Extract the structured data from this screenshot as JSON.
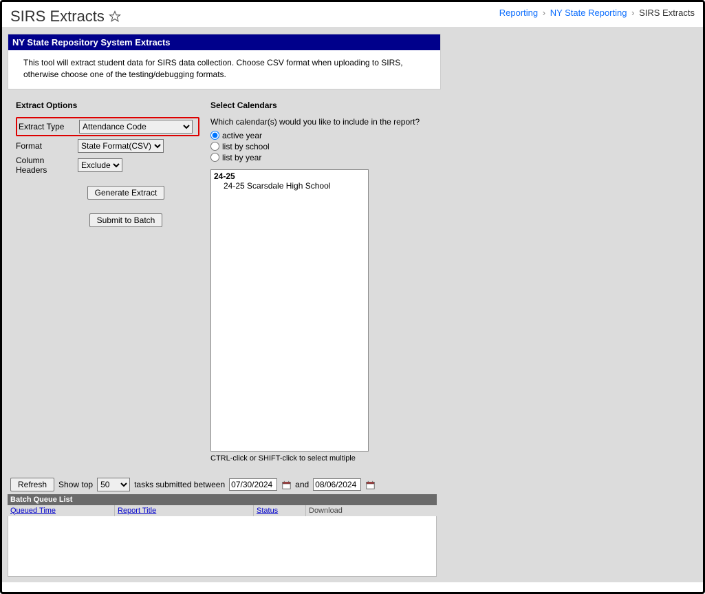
{
  "header": {
    "title": "SIRS Extracts",
    "breadcrumb": {
      "reporting": "Reporting",
      "state": "NY State Reporting",
      "current": "SIRS Extracts"
    }
  },
  "panel": {
    "title": "NY State Repository System Extracts",
    "description": "This tool will extract student data for SIRS data collection. Choose CSV format when uploading to SIRS, otherwise choose one of the testing/debugging formats."
  },
  "extract": {
    "section_label": "Extract Options",
    "type_label": "Extract Type",
    "type_value": "Attendance Code",
    "format_label": "Format",
    "format_value": "State Format(CSV)",
    "colhdr_label": "Column Headers",
    "colhdr_value": "Exclude",
    "generate_btn": "Generate Extract",
    "submit_btn": "Submit to Batch"
  },
  "calendars": {
    "section_label": "Select Calendars",
    "question": "Which calendar(s) would you like to include in the report?",
    "opt_active": "active year",
    "opt_school": "list by school",
    "opt_year": "list by year",
    "year_group": "24-25",
    "item1": "24-25 Scarsdale High School",
    "hint": "CTRL-click or SHIFT-click to select multiple"
  },
  "batch": {
    "refresh_btn": "Refresh",
    "show_top_label": "Show top",
    "show_top_value": "50",
    "between_label": "tasks submitted between",
    "date_from": "07/30/2024",
    "and_label": "and",
    "date_to": "08/06/2024",
    "list_title": "Batch Queue List",
    "col_queued": "Queued Time",
    "col_title": "Report Title",
    "col_status": "Status",
    "col_download": "Download"
  }
}
